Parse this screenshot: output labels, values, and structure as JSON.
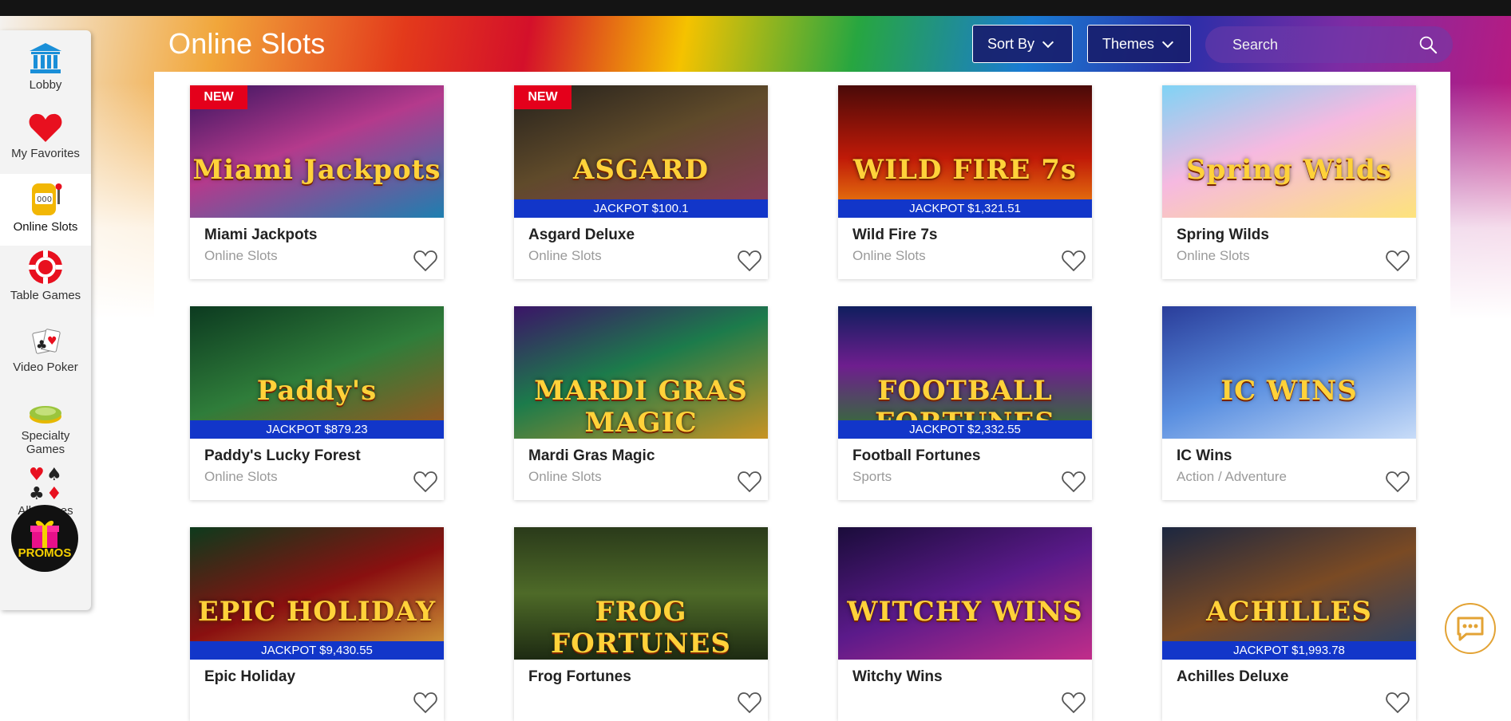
{
  "nav": [
    {
      "label": "Lobby",
      "icon": "bank-icon"
    },
    {
      "label": "My Favorites",
      "icon": "heart-icon"
    },
    {
      "label": "Online Slots",
      "icon": "slot-machine-icon"
    },
    {
      "label": "Table Games",
      "icon": "poker-chip-icon"
    },
    {
      "label": "Video Poker",
      "icon": "playing-cards-icon"
    },
    {
      "label": "Specialty Games",
      "icon": "bingo-dish-icon"
    },
    {
      "label": "All Games",
      "icon": "card-suits-icon"
    }
  ],
  "promos_label": "PROMOS",
  "header": {
    "title": "Online Slots",
    "sort_label": "Sort By",
    "themes_label": "Themes",
    "search_placeholder": "Search"
  },
  "colors": {
    "accent_blue": "#1236c9",
    "new_badge": "#e4001b",
    "dropdown_bg": "#181e6e",
    "promos_text": "#f5d000"
  },
  "games": [
    {
      "name": "Miami Jackpots",
      "category": "Online Slots",
      "badge": "NEW",
      "jackpot": "",
      "logo": "Miami Jackpots",
      "bg": "linear-gradient(160deg,#3a1460 0%,#b43a8c 45%,#1e7fb0 100%)"
    },
    {
      "name": "Asgard Deluxe",
      "category": "Online Slots",
      "badge": "NEW",
      "jackpot": "JACKPOT $100.1",
      "logo": "ASGARD",
      "bg": "linear-gradient(160deg,#24201c 0%,#5f4a2a 45%,#8a3a5e 100%)"
    },
    {
      "name": "Wild Fire 7s",
      "category": "Online Slots",
      "badge": "",
      "jackpot": "JACKPOT $1,321.51",
      "logo": "WILD FIRE 7s",
      "bg": "linear-gradient(180deg,#4a0a08 0%,#c01a08 55%,#f08b10 100%)"
    },
    {
      "name": "Spring Wilds",
      "category": "Online Slots",
      "badge": "",
      "jackpot": "",
      "logo": "Spring Wilds",
      "bg": "linear-gradient(160deg,#7fd3f5 0%,#f6b9e0 45%,#fde37c 100%)"
    },
    {
      "name": "Paddy's Lucky Forest",
      "category": "Online Slots",
      "badge": "",
      "jackpot": "JACKPOT $879.23",
      "logo": "Paddy's",
      "bg": "linear-gradient(160deg,#0c3a20 0%,#2f7d3a 50%,#a3521d 100%)"
    },
    {
      "name": "Mardi Gras Magic",
      "category": "Online Slots",
      "badge": "",
      "jackpot": "",
      "logo": "MARDI GRAS MAGIC",
      "bg": "linear-gradient(160deg,#3b1468 0%,#1c7b4b 45%,#c79324 100%)"
    },
    {
      "name": "Football Fortunes",
      "category": "Sports",
      "badge": "",
      "jackpot": "JACKPOT $2,332.55",
      "logo": "FOOTBALL FORTUNES",
      "bg": "linear-gradient(180deg,#0f1e5e 0%,#6e1e8e 45%,#2b7b2b 100%)"
    },
    {
      "name": "IC Wins",
      "category": "Action / Adventure",
      "badge": "",
      "jackpot": "",
      "logo": "IC WINS",
      "bg": "linear-gradient(160deg,#2a3d9a 0%,#5a8fe0 50%,#c8dcf8 100%)"
    },
    {
      "name": "Epic Holiday",
      "category": "",
      "badge": "",
      "jackpot": "JACKPOT $9,430.55",
      "logo": "EPIC HOLIDAY",
      "bg": "linear-gradient(160deg,#0d3a1c 0%,#8a1010 50%,#d6a43a 100%)"
    },
    {
      "name": "Frog Fortunes",
      "category": "",
      "badge": "",
      "jackpot": "",
      "logo": "FROG FORTUNES",
      "bg": "linear-gradient(180deg,#2a3a1a 0%,#4e6a28 50%,#1d2a12 100%)"
    },
    {
      "name": "Witchy Wins",
      "category": "",
      "badge": "",
      "jackpot": "",
      "logo": "WITCHY WINS",
      "bg": "linear-gradient(160deg,#1a0c3a 0%,#5b1a8a 50%,#c12d8a 100%)"
    },
    {
      "name": "Achilles Deluxe",
      "category": "",
      "badge": "",
      "jackpot": "JACKPOT $1,993.78",
      "logo": "ACHILLES",
      "bg": "linear-gradient(160deg,#1c2740 0%,#7a4a24 50%,#24406a 100%)"
    }
  ]
}
